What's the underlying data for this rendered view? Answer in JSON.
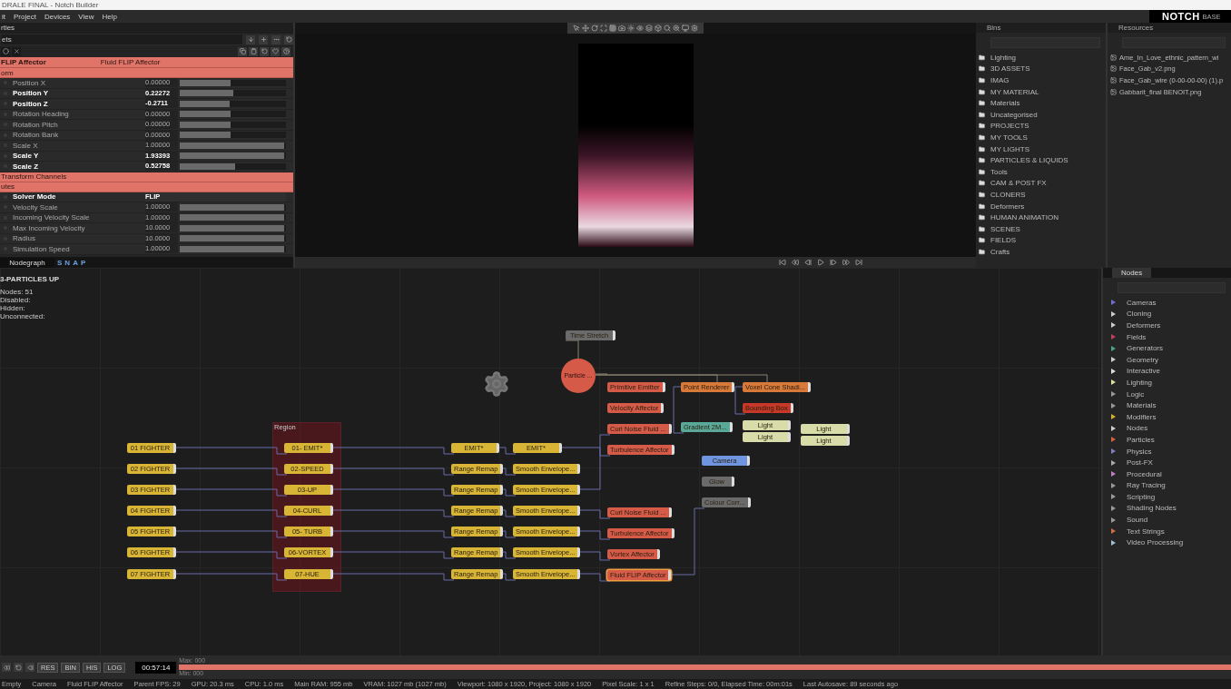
{
  "window": {
    "title": "DRALE FINAL - Notch Builder",
    "logo": "NOTCH",
    "logo_edition": "BASE"
  },
  "menu": [
    "it",
    "Project",
    "Devices",
    "View",
    "Help"
  ],
  "properties": {
    "header": "rties",
    "preset": "ets",
    "node_title": "FLIP Affector",
    "node_type": "Fluid FLIP Affector",
    "sections": [
      {
        "title": "orm",
        "rows": [
          {
            "label": "Position X",
            "value": "0.00000",
            "level": 0.48,
            "modified": false,
            "kind": "slider"
          },
          {
            "label": "Position Y",
            "value": "0.22272",
            "level": 0.5,
            "modified": true,
            "kind": "slider"
          },
          {
            "label": "Position Z",
            "value": "-0.2711",
            "level": 0.47,
            "modified": true,
            "kind": "slider"
          },
          {
            "label": "Rotation Heading",
            "value": "0.00000",
            "level": 0.48,
            "modified": false,
            "kind": "slider"
          },
          {
            "label": "Rotation Pitch",
            "value": "0.00000",
            "level": 0.48,
            "modified": false,
            "kind": "slider"
          },
          {
            "label": "Rotation Bank",
            "value": "0.00000",
            "level": 0.48,
            "modified": false,
            "kind": "slider"
          },
          {
            "label": "Scale X",
            "value": "1.00000",
            "level": 0.98,
            "modified": false,
            "kind": "slider"
          },
          {
            "label": "Scale Y",
            "value": "1.93393",
            "level": 0.98,
            "modified": true,
            "kind": "slider"
          },
          {
            "label": "Scale Z",
            "value": "0.52758",
            "level": 0.52,
            "modified": true,
            "kind": "slider"
          }
        ]
      },
      {
        "title": "Transform Channels"
      },
      {
        "title": "utes",
        "rows": [
          {
            "label": "Solver Mode",
            "value": "FLIP",
            "modified": true,
            "kind": "dropdown"
          },
          {
            "label": "Velocity Scale",
            "value": "1.00000",
            "level": 0.98,
            "modified": false,
            "kind": "slider"
          },
          {
            "label": "Incoming Velocity Scale",
            "value": "1.00000",
            "level": 0.98,
            "modified": false,
            "kind": "slider"
          },
          {
            "label": "Max Incoming Velocity",
            "value": "10.0000",
            "level": 0.98,
            "modified": false,
            "kind": "slider"
          },
          {
            "label": "Radius",
            "value": "10.0000",
            "level": 0.98,
            "modified": false,
            "kind": "slider"
          },
          {
            "label": "Simulation Speed",
            "value": "1.00000",
            "level": 0.98,
            "modified": false,
            "kind": "slider"
          }
        ]
      }
    ],
    "toolbar_tab": "Nodegraph",
    "snap_letters": [
      "S",
      "N",
      "A",
      "P"
    ]
  },
  "bins": {
    "title": "Bins",
    "items": [
      "Lighting",
      "3D ASSETS",
      "IMAG",
      "MY MATERIAL",
      "Materials",
      "Uncategorised",
      "PROJECTS",
      "MY TOOLS",
      "MY LIGHTS",
      "PARTICLES & LIQUIDS",
      "Tools",
      "CAM & POST FX",
      "CLONERS",
      "Deformers",
      "HUMAN ANIMATION",
      "SCENES",
      "FIELDS",
      "Crafts"
    ]
  },
  "resources": {
    "title": "Resources",
    "items": [
      "Ame_In_Love_ethnic_pattern_wi",
      "Face_Gab_v2.png",
      "Face_Gab_wire (0-00-00-00) (1).p",
      "Gabbarit_final BENOIT.png"
    ]
  },
  "nodegraph": {
    "title": "3-PARTICLES UP",
    "stats": [
      {
        "label": "Nodes:",
        "value": "51"
      },
      {
        "label": "Disabled:"
      },
      {
        "label": "Hidden:"
      },
      {
        "label": "Unconnected:"
      }
    ],
    "region": "Region",
    "particle": "Particle ...",
    "nodes": [
      {
        "label": "01 FIGHTER",
        "color": "#d8b535",
        "selected": false
      },
      {
        "label": "02 FIGHTER",
        "color": "#d8b535",
        "selected": false
      },
      {
        "label": "03 FIGHTER",
        "color": "#d8b535",
        "selected": false
      },
      {
        "label": "04 FIGHTER",
        "color": "#d8b535",
        "selected": false
      },
      {
        "label": "05 FIGHTER",
        "color": "#d8b535",
        "selected": false
      },
      {
        "label": "06 FIGHTER",
        "color": "#d8b535",
        "selected": false
      },
      {
        "label": "07 FIGHTER",
        "color": "#d8b535",
        "selected": false
      },
      {
        "label": "01- EMIT*",
        "color": "#d8b535",
        "selected": false
      },
      {
        "label": "02-SPEED",
        "color": "#d8b535",
        "selected": false
      },
      {
        "label": "03-UP",
        "color": "#d8b535",
        "selected": false
      },
      {
        "label": "04-CURL",
        "color": "#d8b535",
        "selected": false
      },
      {
        "label": "05- TURB",
        "color": "#d8b535",
        "selected": false
      },
      {
        "label": "06-VORTEX",
        "color": "#d8b535",
        "selected": false
      },
      {
        "label": "07-HUE",
        "color": "#d8b535",
        "selected": false
      },
      {
        "label": "EMIT*",
        "color": "#d8b535",
        "selected": false
      },
      {
        "label": "Range Remap",
        "color": "#d8b535",
        "selected": false
      },
      {
        "label": "Range Remap",
        "color": "#d8b535",
        "selected": false
      },
      {
        "label": "Range Remap",
        "color": "#d8b535",
        "selected": false
      },
      {
        "label": "Range Remap",
        "color": "#d8b535",
        "selected": false
      },
      {
        "label": "Range Remap",
        "color": "#d8b535",
        "selected": false
      },
      {
        "label": "Range Remap",
        "color": "#d8b535",
        "selected": false
      },
      {
        "label": "EMIT*",
        "color": "#d8b535",
        "selected": false
      },
      {
        "label": "Smooth Envelope...",
        "color": "#d8b535",
        "selected": false
      },
      {
        "label": "Smooth Envelope...",
        "color": "#d8b535",
        "selected": false
      },
      {
        "label": "Smooth Envelope...",
        "color": "#d8b535",
        "selected": false
      },
      {
        "label": "Smooth Envelope...",
        "color": "#d8b535",
        "selected": false
      },
      {
        "label": "Smooth Envelope...",
        "color": "#d8b535",
        "selected": false
      },
      {
        "label": "Smooth Envelope...",
        "color": "#d8b535",
        "selected": false
      },
      {
        "label": "Primitive Emitter",
        "color": "#d65a48",
        "selected": false
      },
      {
        "label": "Velocity Affector",
        "color": "#d65a48",
        "selected": false
      },
      {
        "label": "Curl Noise Fluid ...",
        "color": "#d65a48",
        "selected": false
      },
      {
        "label": "Turbulence Affector",
        "color": "#d65a48",
        "selected": false
      },
      {
        "label": "Curl Noise Fluid ...",
        "color": "#d65a48",
        "selected": false
      },
      {
        "label": "Turbulence Affector",
        "color": "#d65a48",
        "selected": false
      },
      {
        "label": "Vortex Affector",
        "color": "#d65a48",
        "selected": false
      },
      {
        "label": "Fluid FLIP Affector",
        "color": "#d65a48",
        "selected": true
      },
      {
        "label": "Time Stretch",
        "color": "#6a6a6a",
        "selected": false
      },
      {
        "label": "Point Renderer",
        "color": "#d8793a",
        "selected": false
      },
      {
        "label": "Voxel Cone Shadi...",
        "color": "#d8793a",
        "selected": false
      },
      {
        "label": "Bounding Box",
        "color": "#c83828",
        "selected": false
      },
      {
        "label": "Light",
        "color": "#d8dca8",
        "selected": false
      },
      {
        "label": "Light",
        "color": "#d8dca8",
        "selected": false
      },
      {
        "label": "Light",
        "color": "#d8dca8",
        "selected": false
      },
      {
        "label": "Light",
        "color": "#d8dca8",
        "selected": false
      },
      {
        "label": "Gradient 2M...",
        "color": "#5aa898",
        "selected": false
      },
      {
        "label": "Camera",
        "color": "#6f95e0",
        "selected": false
      },
      {
        "label": "Glow",
        "color": "#6a6a6a",
        "selected": false
      },
      {
        "label": "Colour Corr...",
        "color": "#6a6a6a",
        "selected": false
      }
    ]
  },
  "node_library": {
    "tab": "Nodes",
    "items": [
      {
        "label": "Cameras",
        "color": "#6f6fd0"
      },
      {
        "label": "Cloning",
        "color": "#cccccc"
      },
      {
        "label": "Deformers",
        "color": "#cccccc"
      },
      {
        "label": "Fields",
        "color": "#c04060"
      },
      {
        "label": "Generators",
        "color": "#50a090"
      },
      {
        "label": "Geometry",
        "color": "#cccccc"
      },
      {
        "label": "Interactive",
        "color": "#dddddd"
      },
      {
        "label": "Lighting",
        "color": "#e0e0a0"
      },
      {
        "label": "Logic",
        "color": "#999999"
      },
      {
        "label": "Materials",
        "color": "#999999"
      },
      {
        "label": "Modifiers",
        "color": "#d0b030"
      },
      {
        "label": "Nodes",
        "color": "#cccccc"
      },
      {
        "label": "Particles",
        "color": "#d06040"
      },
      {
        "label": "Physics",
        "color": "#8080c0"
      },
      {
        "label": "Post-FX",
        "color": "#aaaaaa"
      },
      {
        "label": "Procedural",
        "color": "#c080c0"
      },
      {
        "label": "Ray Tracing",
        "color": "#999999"
      },
      {
        "label": "Scripting",
        "color": "#999999"
      },
      {
        "label": "Shading Nodes",
        "color": "#999999"
      },
      {
        "label": "Sound",
        "color": "#999999"
      },
      {
        "label": "Text Strings",
        "color": "#d07040"
      },
      {
        "label": "Video Processing",
        "color": "#a0c0d0"
      }
    ]
  },
  "timeline": {
    "buttons": [
      "RES",
      "BIN",
      "HIS",
      "LOG"
    ],
    "time": "00:57:14",
    "min": "Min: 000",
    "max": "Max: 000"
  },
  "status_bar": [
    "Empty",
    "Camera",
    "Fluid FLIP Affector",
    "Parent FPS: 29",
    "GPU: 20.3 ms",
    "CPU: 1.0 ms",
    "Main RAM: 955 mb",
    "VRAM: 1027 mb (1027 mb)",
    "Viewport: 1080 x 1920, Project: 1080 x 1920",
    "Pixel Scale: 1 x 1",
    "Refine Steps: 0/0, Elapsed Time: 00m:01s",
    "Last Autosave: 89 seconds ago"
  ]
}
